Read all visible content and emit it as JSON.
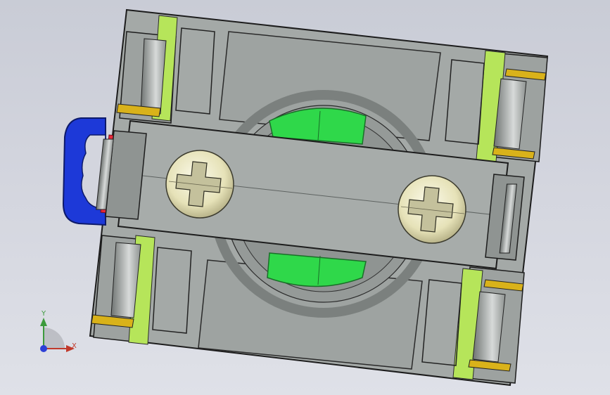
{
  "view": {
    "background_top": "#c9ccd6",
    "background_bottom": "#dfe1e8"
  },
  "model": {
    "colors": {
      "housing_gray": "#a4a9a7",
      "housing_dark": "#8c918f",
      "edge_black": "#1c1c1c",
      "green_contact": "#2fd84a",
      "lime_strip": "#b6e55a",
      "yellow_contact": "#d9b21a",
      "blue_clip": "#1d39d8",
      "red_edge": "#e8283a",
      "screw_cream": "#ece9c6"
    },
    "icons": [
      "screw-phillips-icon",
      "screw-phillips-icon"
    ]
  },
  "triad": {
    "y_label": "Y",
    "x_label": "X",
    "y_color": "#3c9a3c",
    "x_color": "#c0392b",
    "z_color": "#2c3fd6"
  }
}
